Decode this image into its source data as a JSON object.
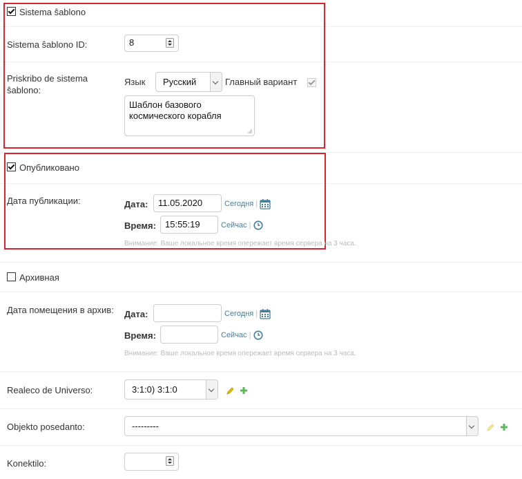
{
  "section1": {
    "checkbox_label": "Sistema ŝablono",
    "id_label": "Sistema ŝablono ID:",
    "id_value": "8",
    "desc_label_line1": "Priskribo de sistema",
    "desc_label_line2": "ŝablono:",
    "language_label": "Язык",
    "language_value": "Русский",
    "main_variant_label": "Главный вариант",
    "description_line1": "Шаблон базового",
    "description_line2": "космического корабля"
  },
  "section2": {
    "checkbox_label": "Опубликовано",
    "pub_date_label": "Дата публикации:",
    "date_label": "Дата:",
    "date_value": "11.05.2020",
    "today_link": "Сегодня",
    "time_label": "Время:",
    "time_value": "15:55:19",
    "now_link": "Сейчас",
    "note": "Внимание: Ваше локальное время опережает время сервера на 3 часа."
  },
  "section3": {
    "checkbox_label": "Архивная",
    "archive_date_label": "Дата помещения в архив:",
    "date_label": "Дата:",
    "date_value": "",
    "today_link": "Сегодня",
    "time_label": "Время:",
    "time_value": "",
    "now_link": "Сейчас",
    "note": "Внимание: Ваше локальное время опережает время сервера на 3 часа."
  },
  "section4": {
    "universe_label": "Realeco de Universo:",
    "universe_value": "3:1:0) 3:1:0",
    "owner_label": "Objekto posedanto:",
    "owner_value": "---------",
    "connector_label": "Konektilo:",
    "connector_value": ""
  },
  "colors": {
    "highlight_border": "#d9232e",
    "link": "#447e9b",
    "edit_icon": "#e6c000",
    "add_icon": "#5cb85c"
  }
}
